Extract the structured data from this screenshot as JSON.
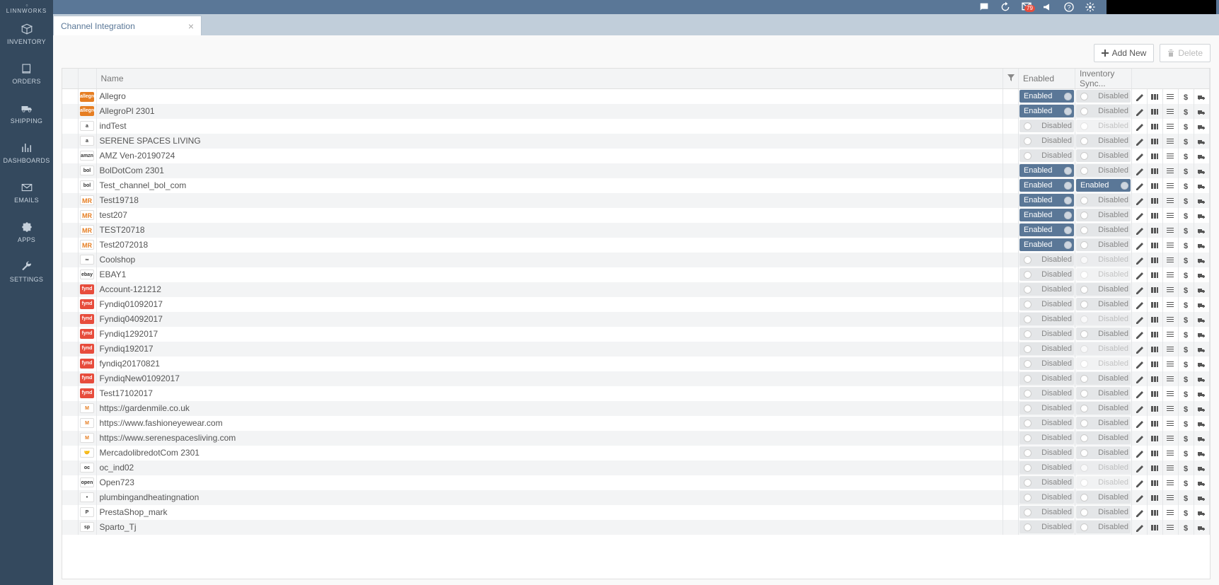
{
  "brand": "LINNWORKS",
  "notif_count": "79",
  "sidebar": [
    {
      "label": "INVENTORY",
      "icon": "cubes"
    },
    {
      "label": "ORDERS",
      "icon": "book"
    },
    {
      "label": "SHIPPING",
      "icon": "truck"
    },
    {
      "label": "DASHBOARDS",
      "icon": "chart"
    },
    {
      "label": "EMAILS",
      "icon": "mail"
    },
    {
      "label": "APPS",
      "icon": "puzzle"
    },
    {
      "label": "SETTINGS",
      "icon": "wrench"
    }
  ],
  "tab": {
    "label": "Channel Integration"
  },
  "buttons": {
    "add": "Add New",
    "delete": "Delete"
  },
  "columns": {
    "name": "Name",
    "enabled": "Enabled",
    "inv": "Inventory Sync..."
  },
  "toggles": {
    "enabled": "Enabled",
    "disabled": "Disabled"
  },
  "rows": [
    {
      "logo": "allegro",
      "logoBg": "#e67e22",
      "logoTx": "allegro",
      "name": "Allegro",
      "en": true,
      "inv": false,
      "invDim": false
    },
    {
      "logo": "allegro",
      "logoBg": "#e67e22",
      "logoTx": "allegro",
      "name": "AllegroPl 2301",
      "en": true,
      "inv": false,
      "invDim": false
    },
    {
      "logo": "amazon",
      "logoBg": "#fff",
      "logoTx": "a",
      "name": "indTest",
      "en": false,
      "inv": false,
      "invDim": true
    },
    {
      "logo": "amazon",
      "logoBg": "#fff",
      "logoTx": "a",
      "name": "SERENE SPACES LIVING",
      "en": false,
      "inv": false,
      "invDim": false
    },
    {
      "logo": "amazon",
      "logoBg": "#fff",
      "logoTx": "amzn",
      "name": "AMZ Ven-20190724",
      "en": false,
      "inv": false,
      "invDim": false
    },
    {
      "logo": "bol",
      "logoBg": "#fff",
      "logoTx": "bol",
      "name": "BolDotCom 2301",
      "en": true,
      "inv": false,
      "invDim": false
    },
    {
      "logo": "bol",
      "logoBg": "#fff",
      "logoTx": "bol",
      "name": "Test_channel_bol_com",
      "en": true,
      "inv": true,
      "invDim": false
    },
    {
      "logo": "mr",
      "logoBg": "#fff",
      "logoTx": "MR",
      "name": "Test19718",
      "en": true,
      "inv": false,
      "invDim": false
    },
    {
      "logo": "mr",
      "logoBg": "#fff",
      "logoTx": "MR",
      "name": "test207",
      "en": true,
      "inv": false,
      "invDim": false
    },
    {
      "logo": "mr",
      "logoBg": "#fff",
      "logoTx": "MR",
      "name": "TEST20718",
      "en": true,
      "inv": false,
      "invDim": false
    },
    {
      "logo": "mr",
      "logoBg": "#fff",
      "logoTx": "MR",
      "name": "Test2072018",
      "en": true,
      "inv": false,
      "invDim": false
    },
    {
      "logo": "cool",
      "logoBg": "#fff",
      "logoTx": "∞",
      "name": "Coolshop",
      "en": false,
      "inv": false,
      "invDim": true
    },
    {
      "logo": "ebay",
      "logoBg": "#fff",
      "logoTx": "ebay",
      "name": "EBAY1",
      "en": false,
      "inv": false,
      "invDim": true
    },
    {
      "logo": "fyndiq",
      "logoBg": "#e74c3c",
      "logoTx": "fynd",
      "name": "Account-121212",
      "en": false,
      "inv": false,
      "invDim": false
    },
    {
      "logo": "fyndiq",
      "logoBg": "#e74c3c",
      "logoTx": "fynd",
      "name": "Fyndiq01092017",
      "en": false,
      "inv": false,
      "invDim": false
    },
    {
      "logo": "fyndiq",
      "logoBg": "#e74c3c",
      "logoTx": "fynd",
      "name": "Fyndiq04092017",
      "en": false,
      "inv": false,
      "invDim": true
    },
    {
      "logo": "fyndiq",
      "logoBg": "#e74c3c",
      "logoTx": "fynd",
      "name": "Fyndiq1292017",
      "en": false,
      "inv": false,
      "invDim": false
    },
    {
      "logo": "fyndiq",
      "logoBg": "#e74c3c",
      "logoTx": "fynd",
      "name": "Fyndiq192017",
      "en": false,
      "inv": false,
      "invDim": true
    },
    {
      "logo": "fyndiq",
      "logoBg": "#e74c3c",
      "logoTx": "fynd",
      "name": "fyndiq20170821",
      "en": false,
      "inv": false,
      "invDim": true
    },
    {
      "logo": "fyndiq",
      "logoBg": "#e74c3c",
      "logoTx": "fynd",
      "name": "FyndiqNew01092017",
      "en": false,
      "inv": false,
      "invDim": false
    },
    {
      "logo": "fyndiq",
      "logoBg": "#e74c3c",
      "logoTx": "fynd",
      "name": "Test17102017",
      "en": false,
      "inv": false,
      "invDim": false
    },
    {
      "logo": "magento",
      "logoBg": "#fff",
      "logoTx": "M",
      "name": "https://gardenmile.co.uk",
      "en": false,
      "inv": false,
      "invDim": false
    },
    {
      "logo": "magento",
      "logoBg": "#fff",
      "logoTx": "M",
      "name": "https://www.fashioneyewear.com",
      "en": false,
      "inv": false,
      "invDim": false
    },
    {
      "logo": "magento",
      "logoBg": "#fff",
      "logoTx": "M",
      "name": "https://www.serenespacesliving.com",
      "en": false,
      "inv": false,
      "invDim": false
    },
    {
      "logo": "ml",
      "logoBg": "#fff",
      "logoTx": "🤝",
      "name": "MercadolibredotCom 2301",
      "en": false,
      "inv": false,
      "invDim": false,
      "highlight": true
    },
    {
      "logo": "oc",
      "logoBg": "#fff",
      "logoTx": "oc",
      "name": "oc_ind02",
      "en": false,
      "inv": false,
      "invDim": true
    },
    {
      "logo": "open",
      "logoBg": "#fff",
      "logoTx": "open",
      "name": "Open723",
      "en": false,
      "inv": false,
      "invDim": true
    },
    {
      "logo": "plumb",
      "logoBg": "#fff",
      "logoTx": "•",
      "name": "plumbingandheatingnation",
      "en": false,
      "inv": false,
      "invDim": false
    },
    {
      "logo": "presta",
      "logoBg": "#fff",
      "logoTx": "P",
      "name": "PrestaShop_mark",
      "en": false,
      "inv": false,
      "invDim": false
    },
    {
      "logo": "sparto",
      "logoBg": "#fff",
      "logoTx": "sp",
      "name": "Sparto_Tj",
      "en": false,
      "inv": false,
      "invDim": false
    }
  ]
}
